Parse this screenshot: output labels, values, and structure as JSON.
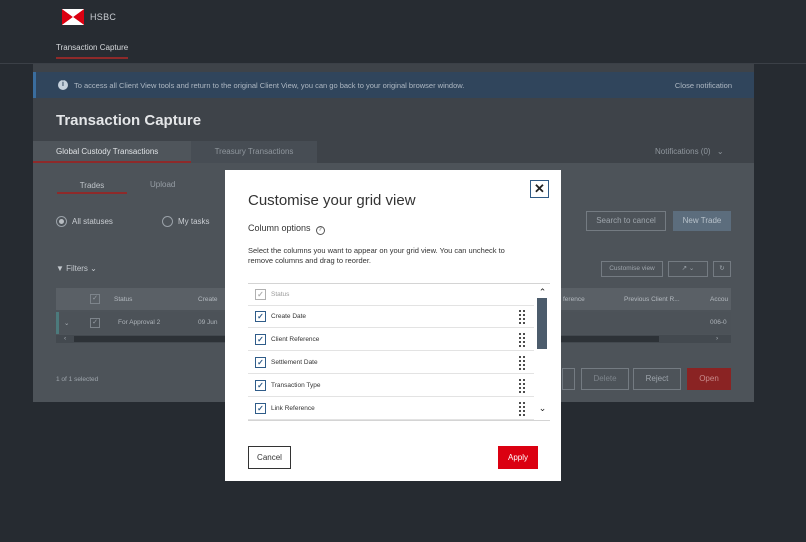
{
  "header": {
    "brand": "HSBC",
    "nav_link": "Transaction Capture"
  },
  "notification": {
    "text": "To access all Client View tools and return to the original Client View, you can go back to your original browser window.",
    "close": "Close notification"
  },
  "page_title": "Transaction Capture",
  "tabs": [
    {
      "label": "Global Custody Transactions",
      "active": true
    },
    {
      "label": "Treasury Transactions",
      "active": false
    }
  ],
  "notifications_label": "Notifications (0)",
  "subtabs": [
    "Trades",
    "Upload"
  ],
  "radios": [
    {
      "label": "All statuses",
      "selected": true
    },
    {
      "label": "My tasks",
      "selected": false
    }
  ],
  "buttons": {
    "search_cancel": "Search to cancel",
    "new_trade": "New Trade",
    "customise_view": "Customise view",
    "delete": "Delete",
    "reject": "Reject",
    "open": "Open"
  },
  "filters_label": "Filters",
  "grid": {
    "headers": [
      "Status",
      "Create",
      "ference",
      "Previous Client R...",
      "Accou"
    ],
    "row": [
      "For Approval 2",
      "09 Jun",
      "006-0"
    ]
  },
  "selection_count": "1 of 1 selected",
  "modal": {
    "title": "Customise your grid view",
    "section_title": "Column options",
    "description": "Select the columns you want to appear on your grid view. You can uncheck to remove columns and drag to reorder.",
    "columns": [
      {
        "label": "Status",
        "checked": true,
        "disabled": true
      },
      {
        "label": "Create Date",
        "checked": true,
        "disabled": false
      },
      {
        "label": "Client Reference",
        "checked": true,
        "disabled": false
      },
      {
        "label": "Settlement Date",
        "checked": true,
        "disabled": false
      },
      {
        "label": "Transaction Type",
        "checked": true,
        "disabled": false
      },
      {
        "label": "Link Reference",
        "checked": true,
        "disabled": false
      }
    ],
    "cancel": "Cancel",
    "apply": "Apply"
  },
  "colors": {
    "brand_red": "#db0011",
    "checkbox_blue": "#2f5c89"
  }
}
